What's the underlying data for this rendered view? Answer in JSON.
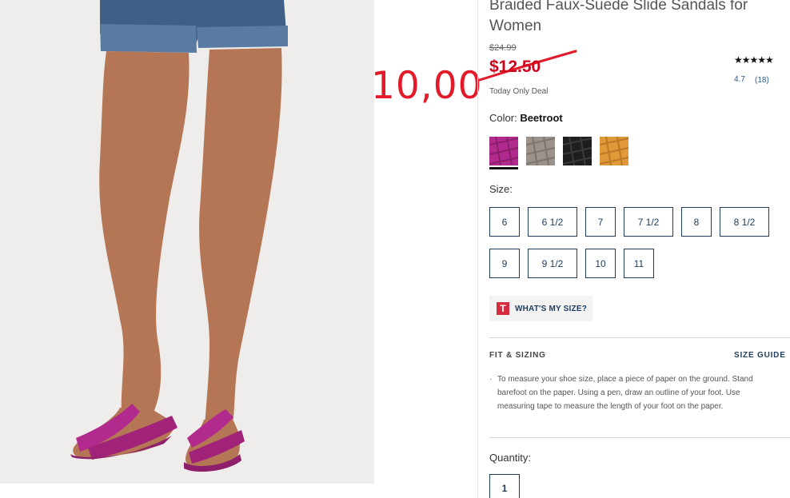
{
  "product": {
    "title": "Braided Faux-Suede Slide Sandals for Women",
    "original_price": "$24.99",
    "sale_price": "$12.50",
    "deal_label": "Today Only Deal",
    "annotation_price": "10,00",
    "annotation_color": "#e31a2a"
  },
  "rating": {
    "stars": "★★★★★",
    "score": "4.7",
    "count": "(18)"
  },
  "color": {
    "label": "Color:",
    "selected": "Beetroot",
    "swatches": [
      {
        "name": "Beetroot",
        "hex": "#b32a8e",
        "selected": true
      },
      {
        "name": "Taupe",
        "hex": "#9a928b",
        "selected": false
      },
      {
        "name": "Black",
        "hex": "#1e1e1e",
        "selected": false
      },
      {
        "name": "Mustard",
        "hex": "#e09838",
        "selected": false
      }
    ]
  },
  "size": {
    "label": "Size:",
    "options": [
      "6",
      "6 1/2",
      "7",
      "7 1/2",
      "8",
      "8 1/2",
      "9",
      "9 1/2",
      "10",
      "11"
    ]
  },
  "whats_my_size": {
    "icon_letter": "T",
    "label": "WHAT'S MY SIZE?"
  },
  "fit": {
    "heading": "FIT & SIZING",
    "size_guide": "SIZE GUIDE",
    "bullet": "·",
    "text": "To measure your shoe size, place a piece of paper on the ground. Stand barefoot on the paper. Using a pen, draw an outline of your foot. Use measuring tape to measure the length of your foot on the paper."
  },
  "quantity": {
    "label": "Quantity:",
    "value": "1"
  },
  "colors": {
    "accent_navy": "#1d3c5e",
    "sale_red": "#d0021b"
  }
}
